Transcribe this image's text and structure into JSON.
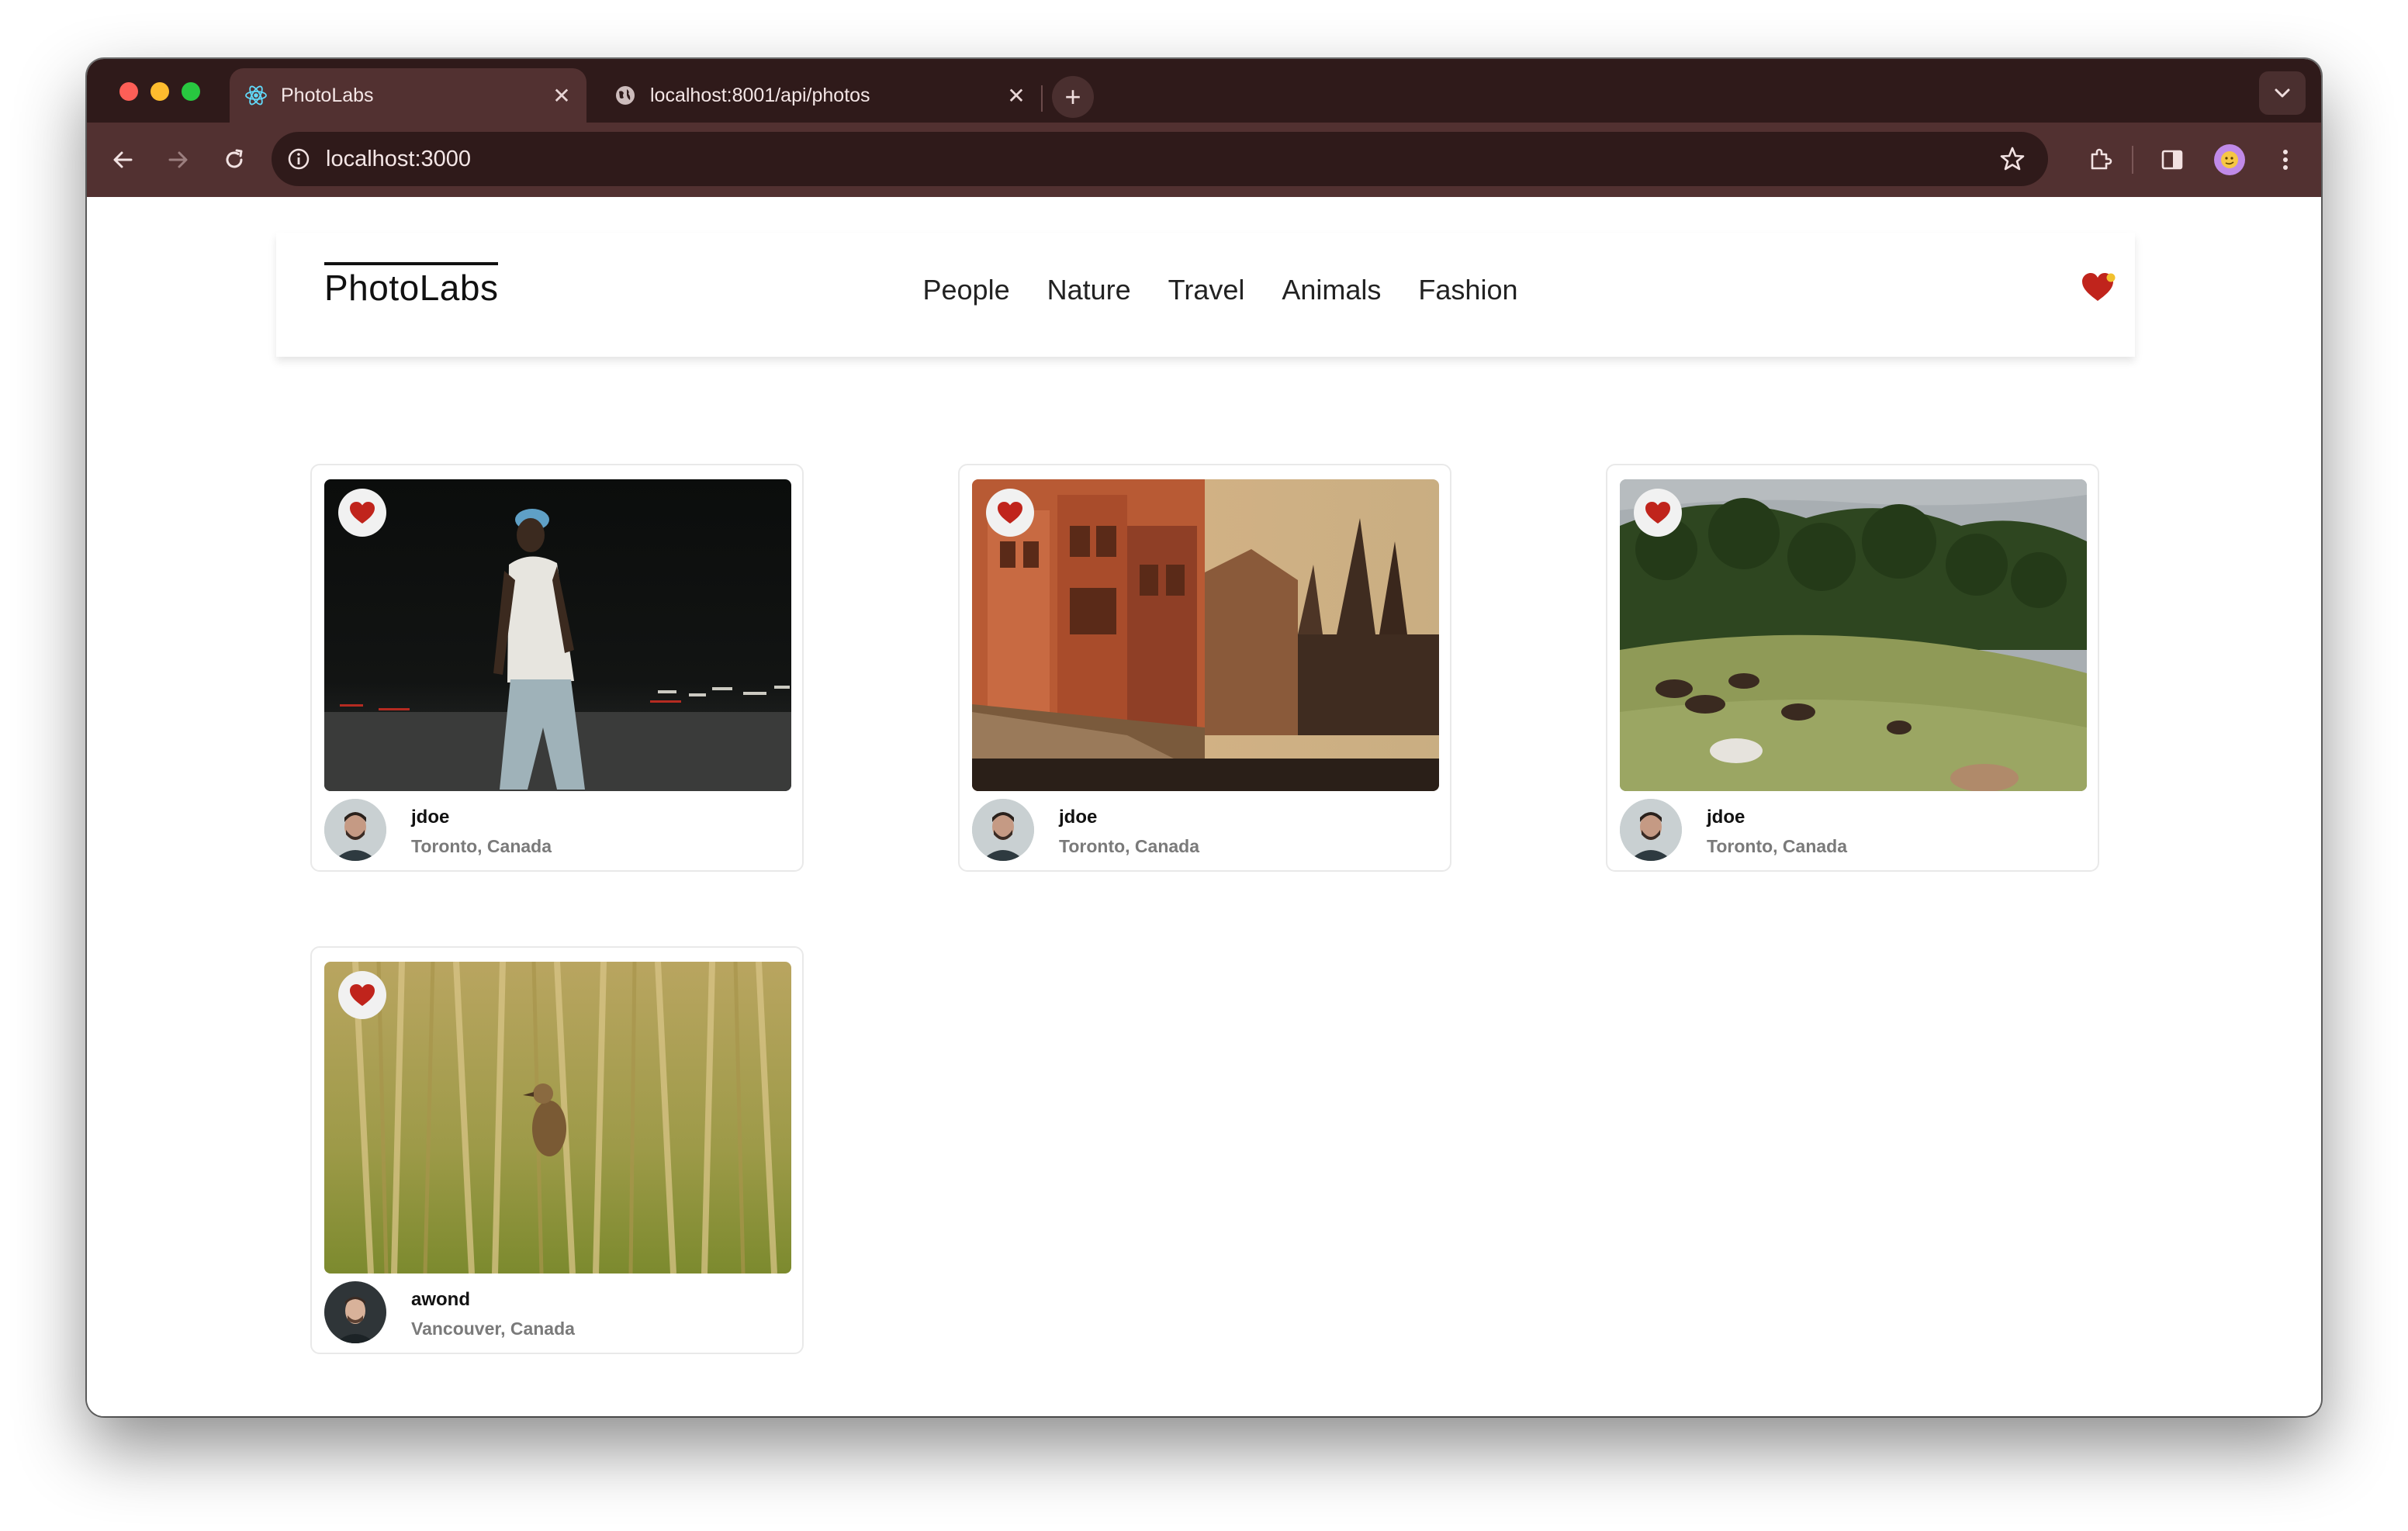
{
  "browser": {
    "tabs": [
      {
        "title": "PhotoLabs",
        "active": true
      },
      {
        "title": "localhost:8001/api/photos",
        "active": false
      }
    ],
    "url": "localhost:3000"
  },
  "app": {
    "logo": "PhotoLabs",
    "topics": [
      "People",
      "Nature",
      "Travel",
      "Animals",
      "Fashion"
    ],
    "accent_color": "#c0241c"
  },
  "photos": [
    {
      "username": "jdoe",
      "location": "Toronto, Canada"
    },
    {
      "username": "jdoe",
      "location": "Toronto, Canada"
    },
    {
      "username": "jdoe",
      "location": "Toronto, Canada"
    },
    {
      "username": "awond",
      "location": "Vancouver, Canada"
    }
  ]
}
